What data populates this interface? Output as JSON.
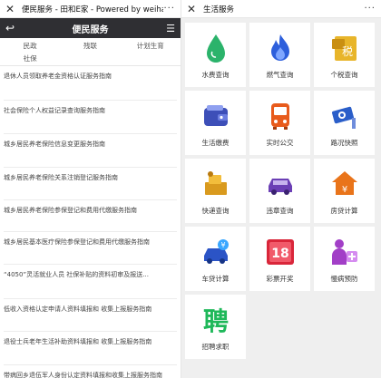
{
  "left": {
    "wx_title": "便民服务 - 田和E家 - Powered by weiha...",
    "wx_more": "···",
    "nav_title": "便民服务",
    "categories": [
      "民政",
      "残联",
      "计划生育",
      "社保"
    ],
    "items": [
      "退休人员领取养老金资格认证服务指南",
      "社会保险个人权益记录查询服务指南",
      "城乡居民养老保险信息变更服务指南",
      "城乡居民养老保险关系注销登记服务指南",
      "城乡居民养老保险参保登记和费用代缴服务指南",
      "城乡居民基本医疗保险参保登记和费用代缴服务指南",
      "“4050”灵活就业人员 社保补贴的资料初审及报送...",
      "低收入资格认定申请人资料填报和 收集上报服务指南",
      "退役士兵老年生活补助资料填报和 收集上报服务指南",
      "带病回乡退伍军人身份认定资料填报和收集上报服务指南"
    ]
  },
  "right": {
    "wx_title": "生活服务",
    "wx_more": "···",
    "services": [
      {
        "label": "水费查询",
        "icon": "water-drop-icon"
      },
      {
        "label": "燃气查询",
        "icon": "flame-icon"
      },
      {
        "label": "个税查询",
        "icon": "tax-icon"
      },
      {
        "label": "生活缴费",
        "icon": "wallet-icon"
      },
      {
        "label": "实时公交",
        "icon": "bus-icon"
      },
      {
        "label": "路况快照",
        "icon": "camera-icon"
      },
      {
        "label": "快递查询",
        "icon": "parcel-icon"
      },
      {
        "label": "违章查询",
        "icon": "car-icon"
      },
      {
        "label": "房贷计算",
        "icon": "house-icon"
      },
      {
        "label": "车贷计算",
        "icon": "car-loan-icon"
      },
      {
        "label": "彩票开奖",
        "icon": "lottery-icon"
      },
      {
        "label": "慢病预防",
        "icon": "health-icon"
      },
      {
        "label": "招聘求职",
        "icon": "recruit-icon"
      }
    ],
    "recruit_glyph": "聘",
    "lottery_number": "18",
    "tax_glyph": "税"
  }
}
